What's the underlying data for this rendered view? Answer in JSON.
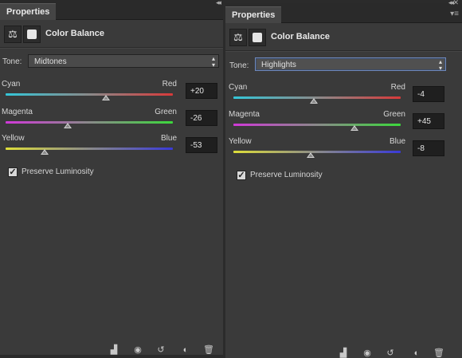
{
  "left": {
    "tab_label": "Properties",
    "collapse_glyph": "◂◂",
    "title": "Color Balance",
    "tone_label": "Tone:",
    "tone_value": "Midtones",
    "sliders": [
      {
        "left": "Cyan",
        "right": "Red",
        "value": "+20",
        "value_num": 20
      },
      {
        "left": "Magenta",
        "right": "Green",
        "value": "-26",
        "value_num": -26
      },
      {
        "left": "Yellow",
        "right": "Blue",
        "value": "-53",
        "value_num": -53
      }
    ],
    "preserve_label": "Preserve Luminosity",
    "preserve_checked": true
  },
  "right": {
    "tab_label": "Properties",
    "collapse_glyph": "◂◂ ✕",
    "menu_glyph": "▾≡",
    "title": "Color Balance",
    "tone_label": "Tone:",
    "tone_value": "Highlights",
    "sliders": [
      {
        "left": "Cyan",
        "right": "Red",
        "value": "-4",
        "value_num": -4
      },
      {
        "left": "Magenta",
        "right": "Green",
        "value": "+45",
        "value_num": 45
      },
      {
        "left": "Yellow",
        "right": "Blue",
        "value": "-8",
        "value_num": -8
      }
    ],
    "preserve_label": "Preserve Luminosity",
    "preserve_checked": true
  },
  "icons": {
    "balance": "balance-scale-icon",
    "mask": "layer-mask-icon",
    "clip": "clip-to-layer-icon",
    "view_previous": "view-previous-state-icon",
    "reset": "reset-icon",
    "visibility": "visibility-icon",
    "delete": "trash-icon"
  },
  "colors": {
    "cyan": "#34c6d8",
    "red": "#d83a3a",
    "magenta": "#d039d8",
    "green": "#3cd83c",
    "yellow": "#dede3a",
    "blue": "#3a3ad8",
    "focus": "#6f88b9"
  }
}
